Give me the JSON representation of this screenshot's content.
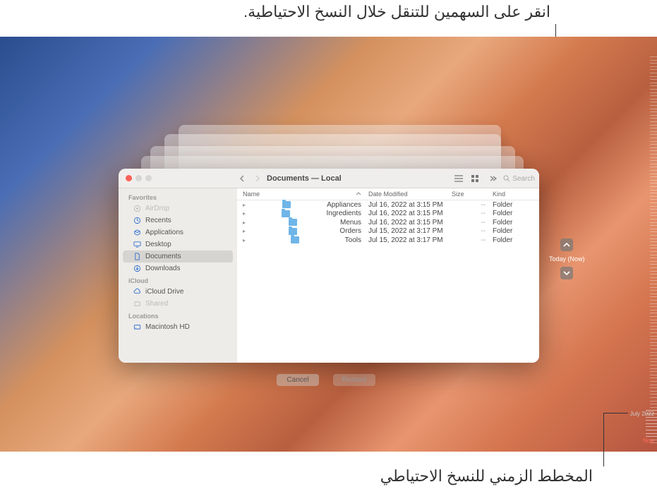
{
  "callouts": {
    "top": "انقر على السهمين للتنقل خلال النسخ الاحتياطية.",
    "bottom": "المخطط الزمني للنسخ الاحتياطي"
  },
  "window": {
    "title": "Documents — Local",
    "search_placeholder": "Search"
  },
  "sidebar": {
    "sections": [
      {
        "title": "Favorites",
        "items": [
          {
            "label": "AirDrop",
            "icon_name": "airdrop-icon",
            "dim": true
          },
          {
            "label": "Recents",
            "icon_name": "clock-icon"
          },
          {
            "label": "Applications",
            "icon_name": "grid-icon"
          },
          {
            "label": "Desktop",
            "icon_name": "desktop-icon"
          },
          {
            "label": "Documents",
            "icon_name": "doc-icon",
            "selected": true
          },
          {
            "label": "Downloads",
            "icon_name": "download-icon"
          }
        ]
      },
      {
        "title": "iCloud",
        "items": [
          {
            "label": "iCloud Drive",
            "icon_name": "cloud-icon"
          },
          {
            "label": "Shared",
            "icon_name": "shared-icon",
            "dim": true
          }
        ]
      },
      {
        "title": "Locations",
        "items": [
          {
            "label": "Macintosh HD",
            "icon_name": "disk-icon"
          }
        ]
      }
    ]
  },
  "columns": {
    "name": "Name",
    "date": "Date Modified",
    "size": "Size",
    "kind": "Kind"
  },
  "files": [
    {
      "name": "Appliances",
      "date": "Jul 16, 2022 at 3:15 PM",
      "size": "--",
      "kind": "Folder"
    },
    {
      "name": "Ingredients",
      "date": "Jul 16, 2022 at 3:15 PM",
      "size": "--",
      "kind": "Folder"
    },
    {
      "name": "Menus",
      "date": "Jul 16, 2022 at 3:15 PM",
      "size": "--",
      "kind": "Folder"
    },
    {
      "name": "Orders",
      "date": "Jul 15, 2022 at 3:17 PM",
      "size": "--",
      "kind": "Folder"
    },
    {
      "name": "Tools",
      "date": "Jul 15, 2022 at 3:17 PM",
      "size": "--",
      "kind": "Folder"
    }
  ],
  "nav": {
    "snapshot_label": "Today (Now)"
  },
  "buttons": {
    "cancel": "Cancel",
    "restore": "Restore"
  },
  "timeline": {
    "month_label": "July 2022",
    "now_label": "Now"
  }
}
